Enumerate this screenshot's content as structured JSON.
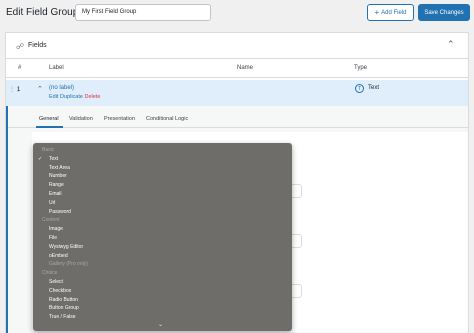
{
  "header": {
    "title": "Edit Field Group",
    "group_name": "My First Field Group",
    "add_field_label": "Add Field",
    "save_label": "Save Changes"
  },
  "panel": {
    "title": "Fields",
    "columns": {
      "num": "#",
      "label": "Label",
      "name": "Name",
      "type": "Type"
    }
  },
  "field_row": {
    "number": "1",
    "label": "(no label)",
    "actions": {
      "edit": "Edit",
      "duplicate": "Duplicate",
      "delete": "Delete"
    },
    "type_icon": "T",
    "type": "Text"
  },
  "tabs": [
    "General",
    "Validation",
    "Presentation",
    "Conditional Logic"
  ],
  "dropdown": {
    "selected": "Text",
    "groups": [
      {
        "label": "Basic",
        "options": [
          {
            "label": "Text",
            "selected": true
          },
          {
            "label": "Text Area"
          },
          {
            "label": "Number"
          },
          {
            "label": "Range"
          },
          {
            "label": "Email"
          },
          {
            "label": "Url"
          },
          {
            "label": "Password"
          }
        ]
      },
      {
        "label": "Content",
        "options": [
          {
            "label": "Image"
          },
          {
            "label": "File"
          },
          {
            "label": "Wysiwyg Editor"
          },
          {
            "label": "oEmbed"
          },
          {
            "label": "Gallery (Pro only)",
            "disabled": true
          }
        ]
      },
      {
        "label": "Choice",
        "options": [
          {
            "label": "Select"
          },
          {
            "label": "Checkbox"
          },
          {
            "label": "Radio Button"
          },
          {
            "label": "Button Group"
          },
          {
            "label": "True / False"
          }
        ]
      }
    ],
    "scroll_icon": "chevron-down-icon"
  },
  "colors": {
    "accent": "#2271b1",
    "delete": "#d63638",
    "dropdown_bg": "#6e6d6a",
    "row_highlight": "#dfeefa"
  }
}
